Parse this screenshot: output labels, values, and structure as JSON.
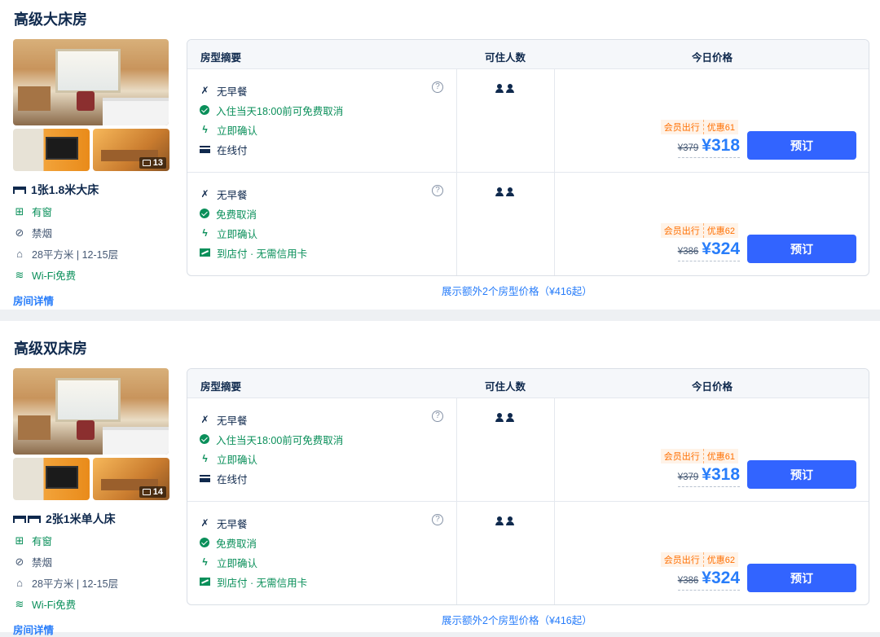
{
  "rooms": [
    {
      "title": "高级大床房",
      "photo_count": "13",
      "bed": "1张1.8米大床",
      "bed_icon_count": 1,
      "window": "有窗",
      "smoking": "禁烟",
      "area": "28平方米 | 12-15层",
      "wifi": "Wi-Fi免费",
      "details_link": "房间详情",
      "header": {
        "summary": "房型摘要",
        "guests": "可住人数",
        "price": "今日价格"
      },
      "rates": [
        {
          "meal": "无早餐",
          "cancel": "入住当天18:00前可免费取消",
          "confirm": "立即确认",
          "payment": "在线付",
          "payment_type": "online",
          "promo_member": "会员出行",
          "promo_discount": "优惠61",
          "orig_price": "¥379",
          "price": "¥318",
          "book": "预订"
        },
        {
          "meal": "无早餐",
          "cancel": "免费取消",
          "confirm": "立即确认",
          "payment": "到店付 · 无需信用卡",
          "payment_type": "store",
          "promo_member": "会员出行",
          "promo_discount": "优惠62",
          "orig_price": "¥386",
          "price": "¥324",
          "book": "预订"
        }
      ],
      "more_prices": "展示额外2个房型价格（¥416起）"
    },
    {
      "title": "高级双床房",
      "photo_count": "14",
      "bed": "2张1米单人床",
      "bed_icon_count": 2,
      "window": "有窗",
      "smoking": "禁烟",
      "area": "28平方米 | 12-15层",
      "wifi": "Wi-Fi免费",
      "details_link": "房间详情",
      "header": {
        "summary": "房型摘要",
        "guests": "可住人数",
        "price": "今日价格"
      },
      "rates": [
        {
          "meal": "无早餐",
          "cancel": "入住当天18:00前可免费取消",
          "confirm": "立即确认",
          "payment": "在线付",
          "payment_type": "online",
          "promo_member": "会员出行",
          "promo_discount": "优惠61",
          "orig_price": "¥379",
          "price": "¥318",
          "book": "预订"
        },
        {
          "meal": "无早餐",
          "cancel": "免费取消",
          "confirm": "立即确认",
          "payment": "到店付 · 无需信用卡",
          "payment_type": "store",
          "promo_member": "会员出行",
          "promo_discount": "优惠62",
          "orig_price": "¥386",
          "price": "¥324",
          "book": "预订"
        }
      ],
      "more_prices": "展示额外2个房型价格（¥416起）"
    }
  ],
  "colors": {
    "accent_blue": "#287dfa",
    "book_button": "#3264ff",
    "green": "#0a8f5a",
    "promo_orange": "#ff6f00"
  }
}
